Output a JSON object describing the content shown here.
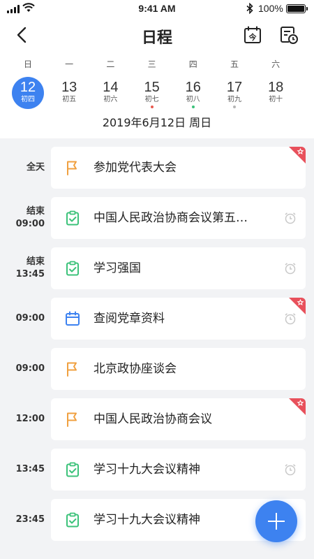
{
  "status_bar": {
    "time": "9:41 AM",
    "battery": "100%"
  },
  "nav": {
    "title": "日程",
    "today_icon_text": "今"
  },
  "week": {
    "days": [
      {
        "weekday": "日",
        "date": "12",
        "lunar": "初四",
        "selected": true,
        "dot": ""
      },
      {
        "weekday": "一",
        "date": "13",
        "lunar": "初五",
        "selected": false,
        "dot": ""
      },
      {
        "weekday": "二",
        "date": "14",
        "lunar": "初六",
        "selected": false,
        "dot": ""
      },
      {
        "weekday": "三",
        "date": "15",
        "lunar": "初七",
        "selected": false,
        "dot": "#e85a4f"
      },
      {
        "weekday": "四",
        "date": "16",
        "lunar": "初八",
        "selected": false,
        "dot": "#3cc27a"
      },
      {
        "weekday": "五",
        "date": "17",
        "lunar": "初九",
        "selected": false,
        "dot": "#b5b5b5"
      },
      {
        "weekday": "六",
        "date": "18",
        "lunar": "初十",
        "selected": false,
        "dot": ""
      }
    ],
    "date_line": "2019年6月12日 周日"
  },
  "events": [
    {
      "time": "全天",
      "time2": "",
      "title": "参加党代表大会",
      "icon": "flag-icon",
      "alarm": false,
      "starred": true
    },
    {
      "time": "结束",
      "time2": "09:00",
      "title": "中国人民政治协商会议第五…",
      "icon": "clipboard-check-icon",
      "alarm": true,
      "starred": false
    },
    {
      "time": "结束",
      "time2": "13:45",
      "title": "学习强国",
      "icon": "clipboard-check-icon",
      "alarm": true,
      "starred": false
    },
    {
      "time": "09:00",
      "time2": "",
      "title": "查阅党章资料",
      "icon": "calendar-icon",
      "alarm": true,
      "starred": true
    },
    {
      "time": "09:00",
      "time2": "",
      "title": "北京政协座谈会",
      "icon": "flag-icon",
      "alarm": false,
      "starred": false
    },
    {
      "time": "12:00",
      "time2": "",
      "title": "中国人民政治协商会议",
      "icon": "flag-icon",
      "alarm": false,
      "starred": true
    },
    {
      "time": "13:45",
      "time2": "",
      "title": "学习十九大会议精神",
      "icon": "clipboard-check-icon",
      "alarm": true,
      "starred": false
    },
    {
      "time": "23:45",
      "time2": "",
      "title": "学习十九大会议精神",
      "icon": "clipboard-check-icon",
      "alarm": false,
      "starred": false
    }
  ],
  "colors": {
    "accent": "#3d82f0",
    "flag": "#f0a040",
    "task": "#3cc27a",
    "ribbon": "#e8505b",
    "alarm": "#c8c8c8"
  }
}
